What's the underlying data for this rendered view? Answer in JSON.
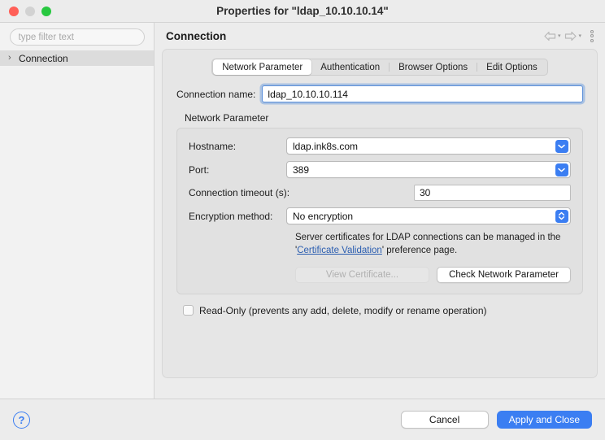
{
  "window": {
    "title": "Properties for \"ldap_10.10.10.14\"",
    "traffic": {
      "close": "close-button",
      "minimize": "minimize-button",
      "maximize": "maximize-button"
    }
  },
  "sidebar": {
    "filter_placeholder": "type filter text",
    "items": [
      {
        "label": "Connection",
        "chevron": "›",
        "selected": true
      }
    ]
  },
  "header": {
    "title": "Connection",
    "back_icon": "back-arrow-icon",
    "forward_icon": "forward-arrow-icon",
    "menu_icon": "kebab-menu-icon",
    "caret": "▾"
  },
  "main": {
    "tabs": [
      {
        "label": "Network Parameter",
        "active": true
      },
      {
        "label": "Authentication",
        "active": false
      },
      {
        "label": "Browser Options",
        "active": false
      },
      {
        "label": "Edit Options",
        "active": false
      }
    ],
    "connection_name": {
      "label": "Connection name:",
      "value": "ldap_10.10.10.114"
    },
    "group": {
      "title": "Network Parameter",
      "hostname": {
        "label": "Hostname:",
        "value": "ldap.ink8s.com"
      },
      "port": {
        "label": "Port:",
        "value": "389"
      },
      "timeout": {
        "label": "Connection timeout (s):",
        "value": "30"
      },
      "encryption": {
        "label": "Encryption method:",
        "value": "No encryption"
      },
      "note": {
        "line1_prefix": "Server certificates for LDAP connections can be managed in the",
        "line2_open_quote": "'",
        "link": "Certificate Validation",
        "line2_suffix": "' preference page."
      },
      "view_certificate_button": "View Certificate...",
      "check_network_button": "Check Network Parameter"
    },
    "read_only": {
      "label": "Read-Only (prevents any add, delete, modify or rename operation)",
      "checked": false
    }
  },
  "footer": {
    "help": "?",
    "cancel": "Cancel",
    "apply": "Apply and Close"
  },
  "colors": {
    "accent": "#3b7ef2",
    "link": "#2a5db0",
    "window_bg": "#ececec",
    "panel_bg": "#e6e6e6",
    "group_bg": "#e1e1e1",
    "focus_ring": "#5b8fd9"
  }
}
